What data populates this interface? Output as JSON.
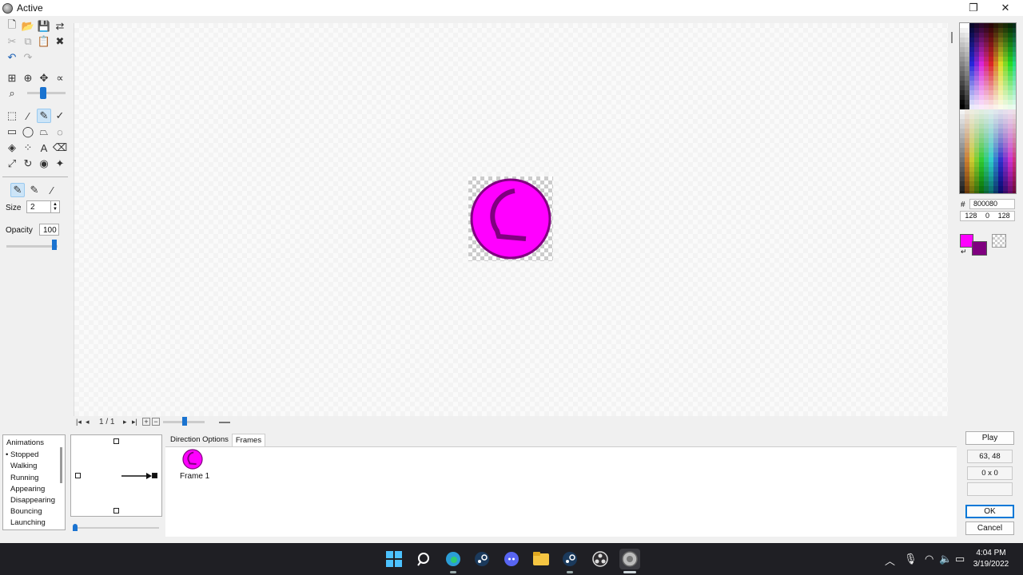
{
  "window": {
    "title": "Active",
    "restore_icon": "restore-icon",
    "close_icon": "close-icon"
  },
  "toolbar": {
    "size_label": "Size",
    "size_value": "2",
    "opacity_label": "Opacity",
    "opacity_value": "100"
  },
  "color": {
    "hex": "800080",
    "r": "128",
    "g": "0",
    "b": "128",
    "foreground": "#ff00ff",
    "background": "#800080"
  },
  "frame_nav": {
    "counter": "1 / 1"
  },
  "animations": {
    "header": "Animations",
    "items": [
      "Stopped",
      "Walking",
      "Running",
      "Appearing",
      "Disappearing",
      "Bouncing",
      "Launching"
    ],
    "selected": "Stopped"
  },
  "tabs": [
    "Direction Options",
    "Frames"
  ],
  "frames": [
    {
      "label": "Frame 1"
    }
  ],
  "right_panel": {
    "play_label": "Play",
    "hotspot": "63, 48",
    "size": "0 x 0",
    "ok_label": "OK",
    "cancel_label": "Cancel"
  },
  "taskbar": {
    "time": "4:04 PM",
    "date": "3/19/2022"
  }
}
